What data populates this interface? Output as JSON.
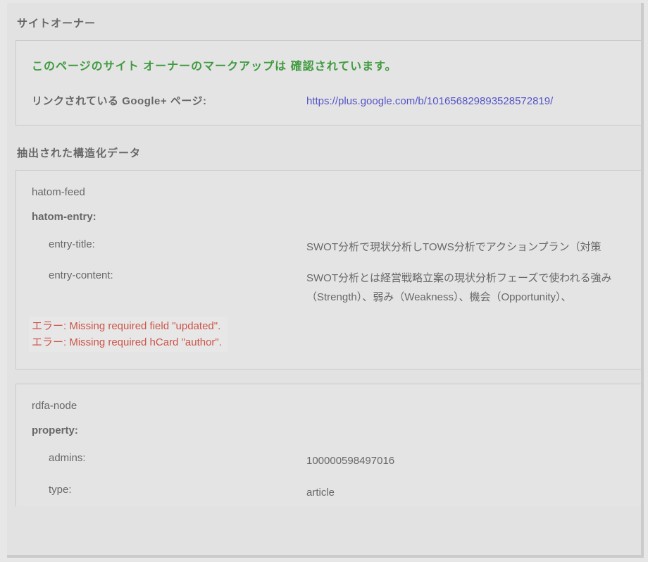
{
  "siteOwner": {
    "heading": "サイトオーナー",
    "verified": "このページのサイト オーナーのマークアップは 確認されています。",
    "linkedLabel": "リンクされている Google+ ページ:",
    "linkedUrl": "https://plus.google.com/b/101656829893528572819/"
  },
  "structured": {
    "heading": "抽出された構造化データ",
    "hatomFeed": {
      "title": "hatom-feed",
      "entryLabel": "hatom-entry:",
      "entryTitleK": "entry-title:",
      "entryTitleV": "SWOT分析で現状分析しTOWS分析でアクションプラン（対策",
      "entryContentK": "entry-content:",
      "entryContentV": "SWOT分析とは経営戦略立案の現状分析フェーズで使われる強み（Strength）、弱み（Weakness）、機会（Opportunity）、",
      "errors": {
        "e1": "エラー: Missing required field \"updated\".",
        "e2": "エラー: Missing required hCard \"author\"."
      }
    },
    "rdfa": {
      "title": "rdfa-node",
      "propertyLabel": "property:",
      "adminsK": "admins:",
      "adminsV": "100000598497016",
      "typeK": "type:",
      "typeV": "article"
    }
  }
}
